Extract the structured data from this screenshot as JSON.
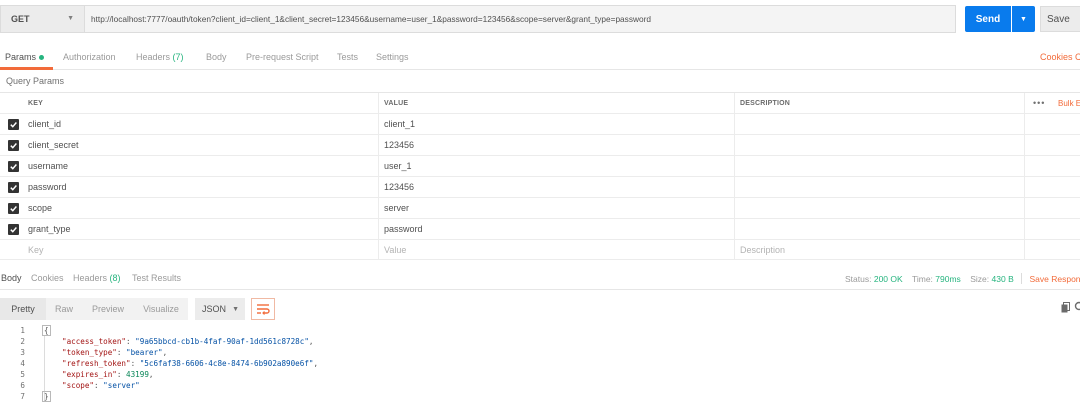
{
  "request": {
    "method": "GET",
    "url": "http://localhost:7777/oauth/token?client_id=client_1&client_secret=123456&username=user_1&password=123456&scope=server&grant_type=password",
    "send_label": "Send",
    "save_label": "Save"
  },
  "request_tabs": [
    {
      "label": "Params",
      "active": true
    },
    {
      "label": "Authorization"
    },
    {
      "label": "Headers",
      "count": "(7)"
    },
    {
      "label": "Body"
    },
    {
      "label": "Pre-request Script"
    },
    {
      "label": "Tests"
    },
    {
      "label": "Settings"
    }
  ],
  "cookies_label": "Cookies",
  "cookies_label_clip": "C",
  "query_params": {
    "title": "Query Params",
    "headers": {
      "key": "KEY",
      "value": "VALUE",
      "description": "DESCRIPTION"
    },
    "bulk_label": "Bulk E",
    "rows": [
      {
        "key": "client_id",
        "value": "client_1"
      },
      {
        "key": "client_secret",
        "value": "123456"
      },
      {
        "key": "username",
        "value": "user_1"
      },
      {
        "key": "password",
        "value": "123456"
      },
      {
        "key": "scope",
        "value": "server"
      },
      {
        "key": "grant_type",
        "value": "password"
      }
    ],
    "placeholders": {
      "key": "Key",
      "value": "Value",
      "description": "Description"
    }
  },
  "response_tabs": [
    {
      "label": "Body",
      "active": true
    },
    {
      "label": "Cookies"
    },
    {
      "label": "Headers",
      "count": "(8)"
    },
    {
      "label": "Test Results"
    }
  ],
  "status": {
    "status_label": "Status:",
    "status_value": "200 OK",
    "time_label": "Time:",
    "time_value": "790ms",
    "size_label": "Size:",
    "size_value": "430 B",
    "save_response": "Save Response"
  },
  "body_views": [
    "Pretty",
    "Raw",
    "Preview",
    "Visualize"
  ],
  "format": "JSON",
  "code_lines": [
    {
      "n": "1",
      "text": "{"
    },
    {
      "n": "2",
      "key": "\"access_token\"",
      "value": "\"9a65bbcd-cb1b-4faf-90af-1dd561c8728c\"",
      "comma": ","
    },
    {
      "n": "3",
      "key": "\"token_type\"",
      "value": "\"bearer\"",
      "comma": ","
    },
    {
      "n": "4",
      "key": "\"refresh_token\"",
      "value": "\"5c6faf38-6606-4c8e-8474-6b902a890e6f\"",
      "comma": ","
    },
    {
      "n": "5",
      "key": "\"expires_in\"",
      "value": "43199",
      "comma": ","
    },
    {
      "n": "6",
      "key": "\"scope\"",
      "value": "\"server\"",
      "comma": ""
    },
    {
      "n": "7",
      "text": "}"
    }
  ],
  "colors": {
    "accent": "#f26b3a",
    "primary": "#097bed",
    "success": "#26b47f"
  }
}
